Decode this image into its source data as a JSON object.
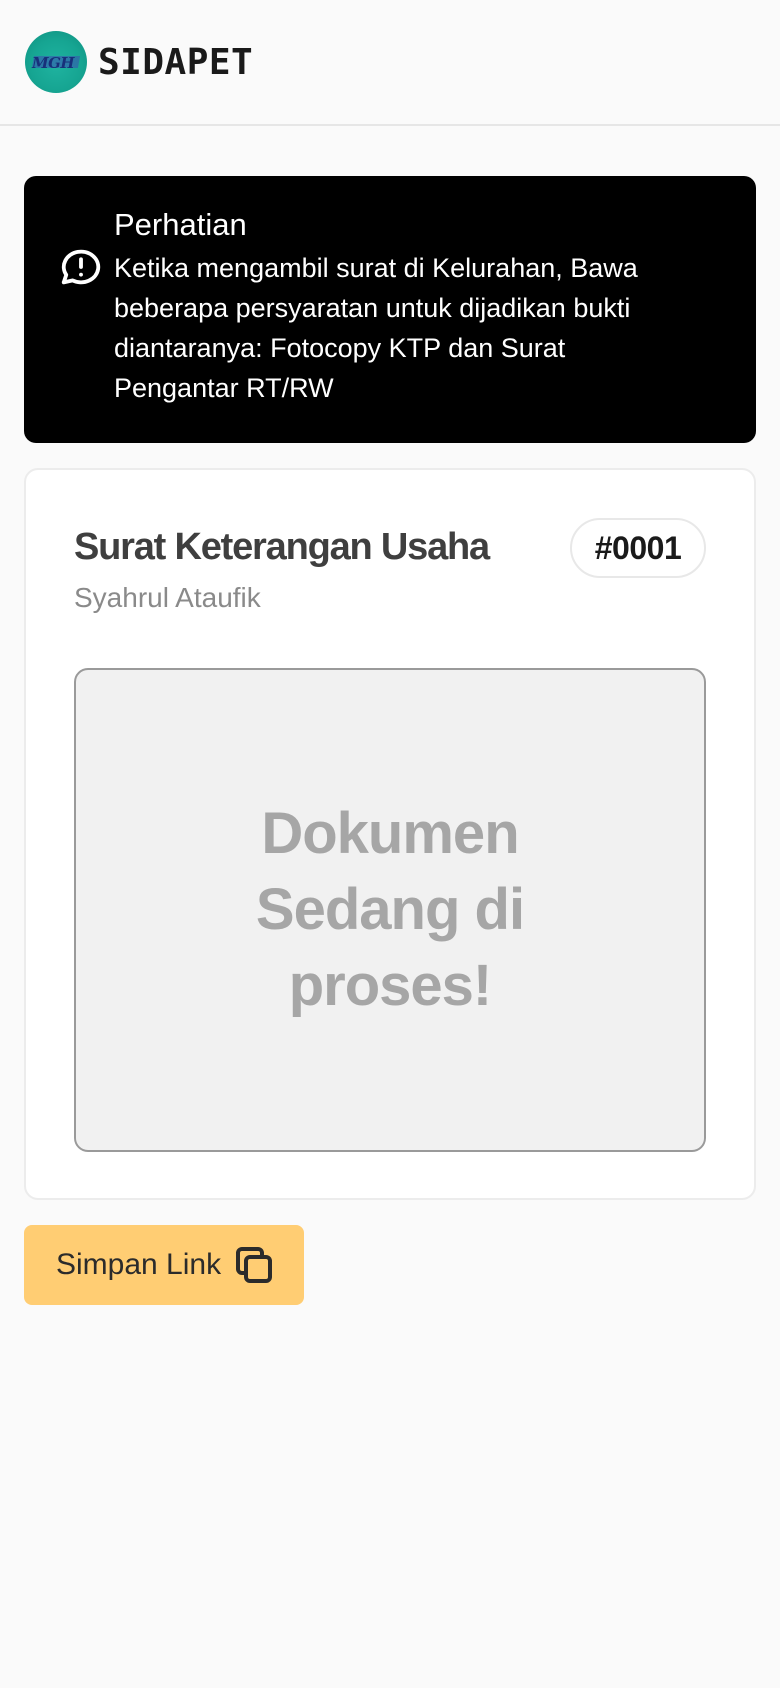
{
  "navbar": {
    "brand": "SIDAPET",
    "logo_text": "MGH",
    "logo_icon": "community-logo"
  },
  "alert": {
    "icon": "message-alert-icon",
    "title": "Perhatian",
    "message": "Ketika mengambil surat di Kelurahan, Bawa beberapa persyaratan untuk dijadikan bukti diantaranya: Fotocopy KTP dan Surat Pengantar RT/RW"
  },
  "card": {
    "title": "Surat Keterangan Usaha",
    "applicant": "Syahrul Ataufik",
    "number": "#0001",
    "document_status": "Dokumen Sedang di proses!"
  },
  "actions": {
    "save_link_label": "Simpan Link",
    "save_link_icon": "copy-icon"
  },
  "colors": {
    "alert_bg": "#000000",
    "button_bg": "#ffcd73",
    "logo_bg": "#16a592",
    "page_bg": "#fafafa"
  }
}
